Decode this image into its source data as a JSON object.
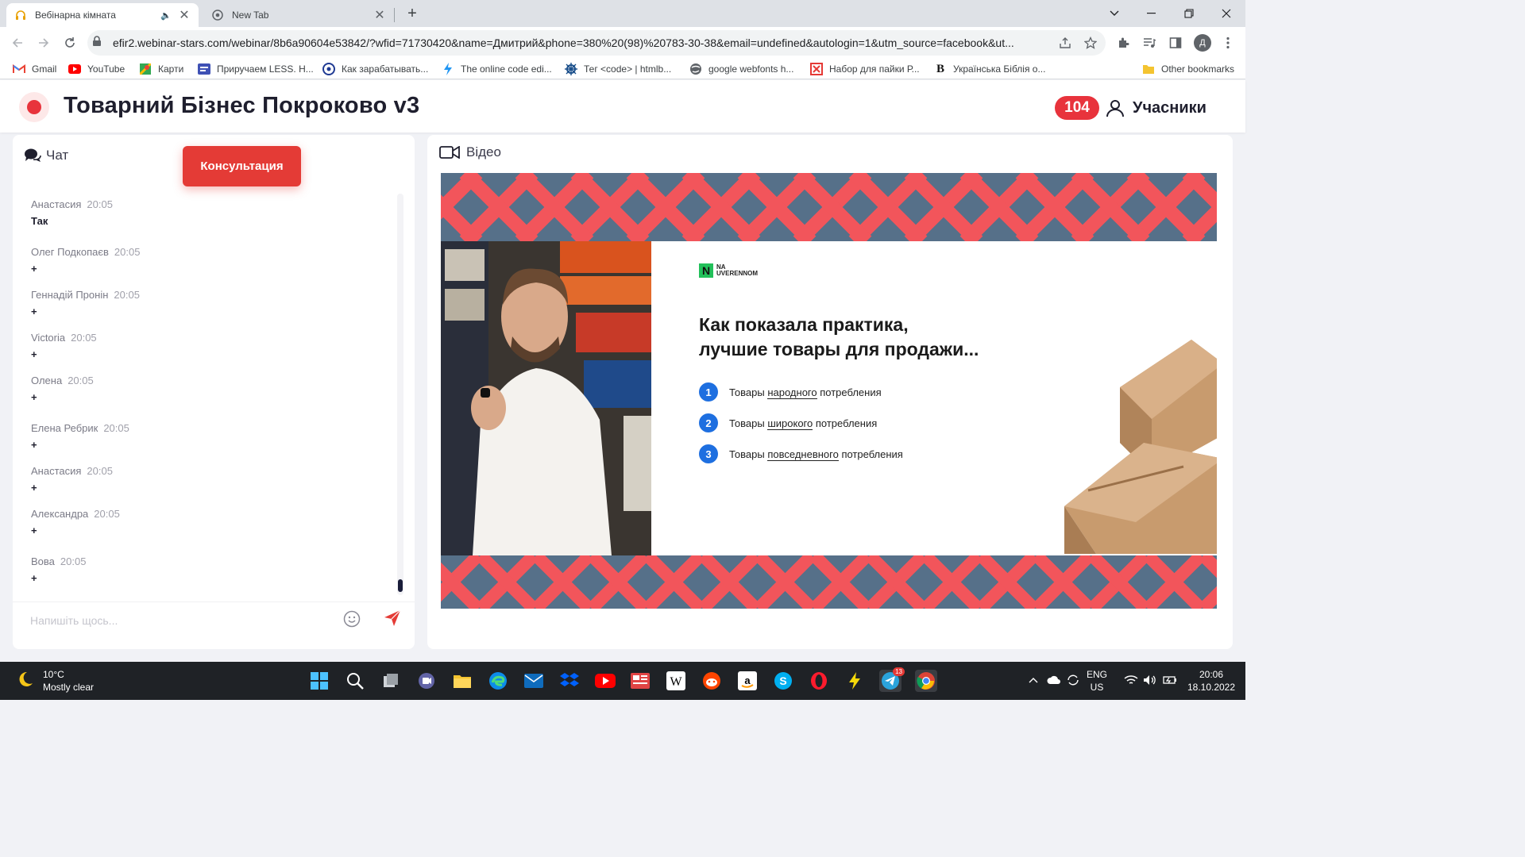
{
  "browser": {
    "tabs": [
      {
        "title": "Вебінарна кімната",
        "active": true
      },
      {
        "title": "New Tab",
        "active": false
      }
    ],
    "url": "efir2.webinar-stars.com/webinar/8b6a90604e53842/?wfid=71730420&name=Дмитрий&phone=380%20(98)%20783-30-38&email=undefined&autologin=1&utm_source=facebook&ut...",
    "profile_initial": "Д",
    "bookmarks": [
      "Gmail",
      "YouTube",
      "Карти",
      "Приручаем LESS. Н...",
      "Как зарабатывать...",
      "The online code edi...",
      "Тег <code> | htmlb...",
      "google webfonts h...",
      "Набор для пайки Р...",
      "Українська Біблія о..."
    ],
    "other_bookmarks": "Other bookmarks"
  },
  "header": {
    "title": "Товарний Бізнес Покроково v3",
    "participants_count": "104",
    "participants_label": "Учасники"
  },
  "chat": {
    "title": "Чат",
    "consult_button": "Консультация",
    "input_placeholder": "Напишіть щось...",
    "messages": [
      {
        "author": "Анастасия",
        "time": "20:05",
        "text": "Так"
      },
      {
        "author": "Олег Подкопаєв",
        "time": "20:05",
        "text": "+"
      },
      {
        "author": "Геннадій Пронін",
        "time": "20:05",
        "text": "+"
      },
      {
        "author": "Victoria",
        "time": "20:05",
        "text": "+"
      },
      {
        "author": "Олена",
        "time": "20:05",
        "text": "+"
      },
      {
        "author": "Елена Ребрик",
        "time": "20:05",
        "text": "+"
      },
      {
        "author": "Анастасия",
        "time": "20:05",
        "text": "+"
      },
      {
        "author": "Александра",
        "time": "20:05",
        "text": "+"
      },
      {
        "author": "Вова",
        "time": "20:05",
        "text": "+"
      }
    ]
  },
  "video": {
    "title": "Відео",
    "slide": {
      "brand_line1": "NA",
      "brand_line2": "UVERENNOM",
      "heading_line1": "Как показала практика,",
      "heading_line2": "лучшие товары для продажи...",
      "items": [
        {
          "num": "1",
          "prefix": "Товары ",
          "underlined": "народного",
          "suffix": " потребления"
        },
        {
          "num": "2",
          "prefix": "Товары ",
          "underlined": "широкого",
          "suffix": " потребления"
        },
        {
          "num": "3",
          "prefix": "Товары ",
          "underlined": "повседневного",
          "suffix": " потребления"
        }
      ]
    }
  },
  "taskbar": {
    "temperature": "10°C",
    "weather": "Mostly clear",
    "language": "ENG",
    "region": "US",
    "time": "20:06",
    "date": "18.10.2022",
    "telegram_badge": "13"
  },
  "colors": {
    "accent_red": "#e8333c",
    "consult_red": "#e43b36",
    "slide_blue": "#567089",
    "slide_coral": "#f2555b"
  }
}
